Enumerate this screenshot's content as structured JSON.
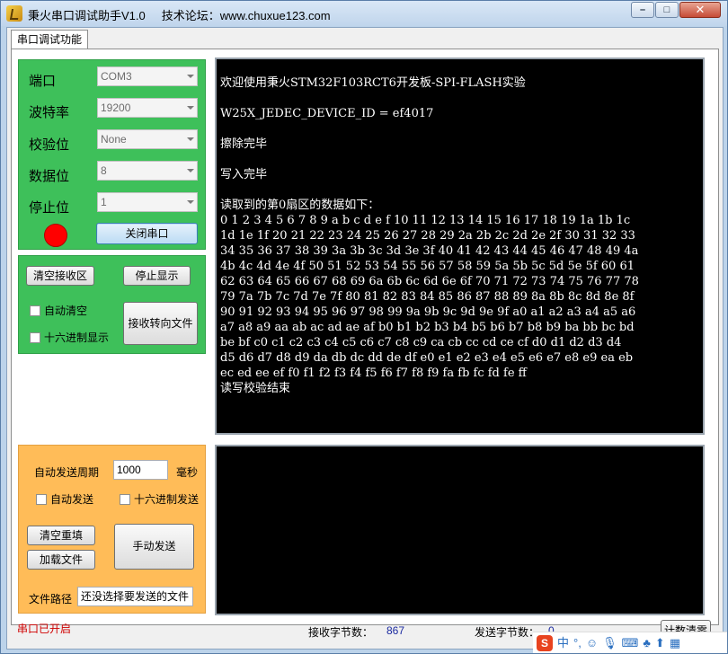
{
  "window": {
    "title": "秉火串口调试助手V1.0",
    "subtitle": "技术论坛：www.chuxue123.com",
    "controls": {
      "minimize": "–",
      "maximize": "□",
      "close": "✕"
    }
  },
  "tabs": [
    {
      "label": "串口调试功能"
    }
  ],
  "serial_settings": {
    "port": {
      "label": "端口",
      "value": "COM3"
    },
    "baud": {
      "label": "波特率",
      "value": "19200"
    },
    "parity": {
      "label": "校验位",
      "value": "None"
    },
    "databits": {
      "label": "数据位",
      "value": "8"
    },
    "stopbits": {
      "label": "停止位",
      "value": "1"
    },
    "toggle_button": "关闭串口",
    "led_color": "#ff0000"
  },
  "receive_controls": {
    "clear_button": "清空接收区",
    "stop_display_button": "停止显示",
    "auto_clear_label": "自动清空",
    "hex_display_label": "十六进制显示",
    "redirect_button": "接收转向文件"
  },
  "receive_console": {
    "lines": [
      "欢迎使用秉火STM32F103RCT6开发板-SPI-FLASH实验",
      "",
      "W25X_JEDEC_DEVICE_ID = ef4017",
      "",
      "擦除完毕",
      "",
      "写入完毕",
      "",
      "读取到的第0扇区的数据如下：",
      "0 1 2 3 4 5 6 7 8 9 a b c d e f 10 11 12 13 14 15 16 17 18 19 1a 1b 1c",
      "1d 1e 1f 20 21 22 23 24 25 26 27 28 29 2a 2b 2c 2d 2e 2f 30 31 32 33",
      "34 35 36 37 38 39 3a 3b 3c 3d 3e 3f 40 41 42 43 44 45 46 47 48 49 4a",
      "4b 4c 4d 4e 4f 50 51 52 53 54 55 56 57 58 59 5a 5b 5c 5d 5e 5f 60 61",
      "62 63 64 65 66 67 68 69 6a 6b 6c 6d 6e 6f 70 71 72 73 74 75 76 77 78",
      "79 7a 7b 7c 7d 7e 7f 80 81 82 83 84 85 86 87 88 89 8a 8b 8c 8d 8e 8f",
      "90 91 92 93 94 95 96 97 98 99 9a 9b 9c 9d 9e 9f a0 a1 a2 a3 a4 a5 a6",
      "a7 a8 a9 aa ab ac ad ae af b0 b1 b2 b3 b4 b5 b6 b7 b8 b9 ba bb bc bd",
      "be bf c0 c1 c2 c3 c4 c5 c6 c7 c8 c9 ca cb cc cd ce cf d0 d1 d2 d3 d4",
      "d5 d6 d7 d8 d9 da db dc dd de df e0 e1 e2 e3 e4 e5 e6 e7 e8 e9 ea eb",
      "ec ed ee ef f0 f1 f2 f3 f4 f5 f6 f7 f8 f9 fa fb fc fd fe ff",
      "读写校验结束"
    ]
  },
  "send_controls": {
    "period_label": "自动发送周期",
    "period_value": "1000",
    "period_unit": "毫秒",
    "auto_send_label": "自动发送",
    "hex_send_label": "十六进制发送",
    "clear_refill_button": "清空重填",
    "load_file_button": "加载文件",
    "manual_send_button": "手动发送",
    "file_path_label": "文件路径",
    "file_path_value": "还没选择要发送的文件"
  },
  "status": {
    "port_state": "串口已开启",
    "rx_label": "接收字节数：",
    "rx_count": "867",
    "tx_label": "发送字节数：",
    "tx_count": "0",
    "reset_counter_button": "计数清零"
  },
  "ime": {
    "logo": "S",
    "lang": "中",
    "punct": "°,",
    "icons": [
      "smile-icon",
      "mic-icon",
      "keyboard-icon",
      "skin-icon",
      "shirt-icon",
      "grid-icon"
    ]
  }
}
